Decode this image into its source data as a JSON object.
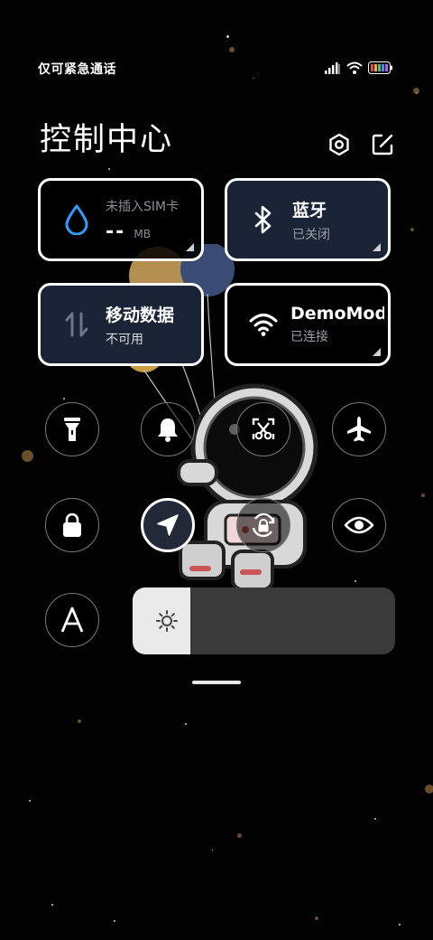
{
  "status_bar": {
    "carrier_text": "仅可紧急通话",
    "icons": [
      "signal-icon",
      "wifi-icon",
      "battery-icon"
    ]
  },
  "header": {
    "title": "控制中心",
    "actions": [
      "settings-icon",
      "edit-icon"
    ]
  },
  "tiles": {
    "data_usage": {
      "sim_status": "未插入SIM卡",
      "usage_value": "--",
      "usage_unit": "MB",
      "icon": "water-drop-icon"
    },
    "bluetooth": {
      "label": "蓝牙",
      "status": "已关闭",
      "icon": "bluetooth-icon"
    },
    "mobile_data": {
      "label": "移动数据",
      "status": "不可用",
      "icon": "mobile-data-icon"
    },
    "wifi": {
      "label": "DemoMod",
      "status": "已连接",
      "icon": "wifi-icon"
    }
  },
  "toggles": [
    {
      "name": "flashlight",
      "icon": "flashlight-icon",
      "active": false
    },
    {
      "name": "mute",
      "icon": "bell-icon",
      "active": false
    },
    {
      "name": "screenshot",
      "icon": "scissors-icon",
      "active": false
    },
    {
      "name": "airplane-mode",
      "icon": "airplane-icon",
      "active": false
    },
    {
      "name": "lock-screen",
      "icon": "lock-icon",
      "active": false
    },
    {
      "name": "location",
      "icon": "location-arrow-icon",
      "active": true
    },
    {
      "name": "rotation-lock",
      "icon": "rotation-lock-icon",
      "active": false
    },
    {
      "name": "reading-mode",
      "icon": "eye-icon",
      "active": false
    },
    {
      "name": "auto-brightness",
      "icon": "font-a-icon",
      "active": false
    }
  ],
  "brightness": {
    "icon": "sun-icon",
    "level_percent": 22
  },
  "colors": {
    "tile_active_bg": "#1b2436",
    "drop_blue": "#2f9cff",
    "slider_fill": "#eaeaea",
    "slider_track": "#3a3a3a"
  }
}
